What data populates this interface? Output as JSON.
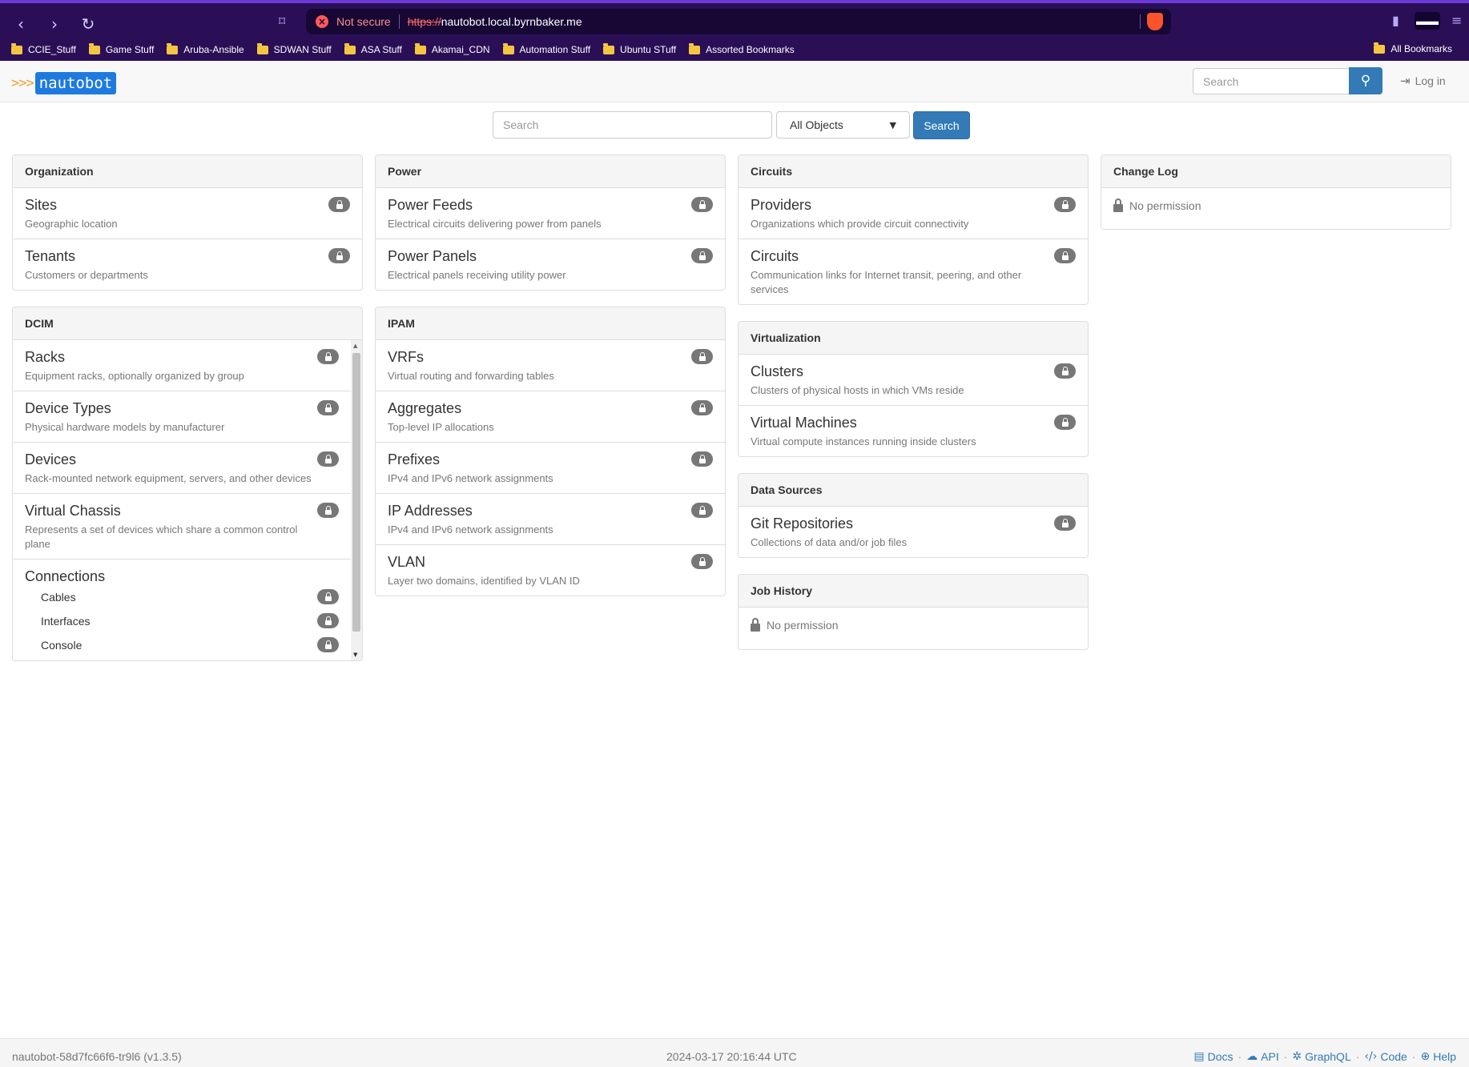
{
  "browser": {
    "not_secure": "Not secure",
    "url_scheme": "https://",
    "url_host": "nautobot.local.byrnbaker.me",
    "bookmarks": [
      "CCIE_Stuff",
      "Game Stuff",
      "Aruba-Ansible",
      "SDWAN Stuff",
      "ASA Stuff",
      "Akamai_CDN",
      "Automation Stuff",
      "Ubuntu STuff",
      "Assorted Bookmarks"
    ],
    "all_bookmarks": "All Bookmarks"
  },
  "navbar": {
    "logo_arrows": ">>>",
    "logo_text": "nautobot",
    "search_placeholder": "Search",
    "login": "Log in"
  },
  "search": {
    "placeholder": "Search",
    "object_select": "All Objects",
    "button": "Search"
  },
  "panels": {
    "organization": {
      "title": "Organization",
      "items": [
        {
          "title": "Sites",
          "desc": "Geographic location"
        },
        {
          "title": "Tenants",
          "desc": "Customers or departments"
        }
      ]
    },
    "dcim": {
      "title": "DCIM",
      "items": [
        {
          "title": "Racks",
          "desc": "Equipment racks, optionally organized by group"
        },
        {
          "title": "Device Types",
          "desc": "Physical hardware models by manufacturer"
        },
        {
          "title": "Devices",
          "desc": "Rack-mounted network equipment, servers, and other devices"
        },
        {
          "title": "Virtual Chassis",
          "desc": "Represents a set of devices which share a common control plane"
        }
      ],
      "connections": {
        "title": "Connections",
        "subs": [
          "Cables",
          "Interfaces",
          "Console"
        ]
      }
    },
    "power": {
      "title": "Power",
      "items": [
        {
          "title": "Power Feeds",
          "desc": "Electrical circuits delivering power from panels"
        },
        {
          "title": "Power Panels",
          "desc": "Electrical panels receiving utility power"
        }
      ]
    },
    "ipam": {
      "title": "IPAM",
      "items": [
        {
          "title": "VRFs",
          "desc": "Virtual routing and forwarding tables"
        },
        {
          "title": "Aggregates",
          "desc": "Top-level IP allocations"
        },
        {
          "title": "Prefixes",
          "desc": "IPv4 and IPv6 network assignments"
        },
        {
          "title": "IP Addresses",
          "desc": "IPv4 and IPv6 network assignments"
        },
        {
          "title": "VLAN",
          "desc": "Layer two domains, identified by VLAN ID"
        }
      ]
    },
    "circuits": {
      "title": "Circuits",
      "items": [
        {
          "title": "Providers",
          "desc": "Organizations which provide circuit connectivity"
        },
        {
          "title": "Circuits",
          "desc": "Communication links for Internet transit, peering, and other services"
        }
      ]
    },
    "virtualization": {
      "title": "Virtualization",
      "items": [
        {
          "title": "Clusters",
          "desc": "Clusters of physical hosts in which VMs reside"
        },
        {
          "title": "Virtual Machines",
          "desc": "Virtual compute instances running inside clusters"
        }
      ]
    },
    "data_sources": {
      "title": "Data Sources",
      "items": [
        {
          "title": "Git Repositories",
          "desc": "Collections of data and/or job files"
        }
      ]
    },
    "job_history": {
      "title": "Job History",
      "no_permission": "No permission"
    },
    "change_log": {
      "title": "Change Log",
      "no_permission": "No permission"
    }
  },
  "footer": {
    "version": "nautobot-58d7fc66f6-tr9l6 (v1.3.5)",
    "timestamp": "2024-03-17 20:16:44 UTC",
    "links": [
      "Docs",
      "API",
      "GraphQL",
      "Code",
      "Help"
    ]
  }
}
